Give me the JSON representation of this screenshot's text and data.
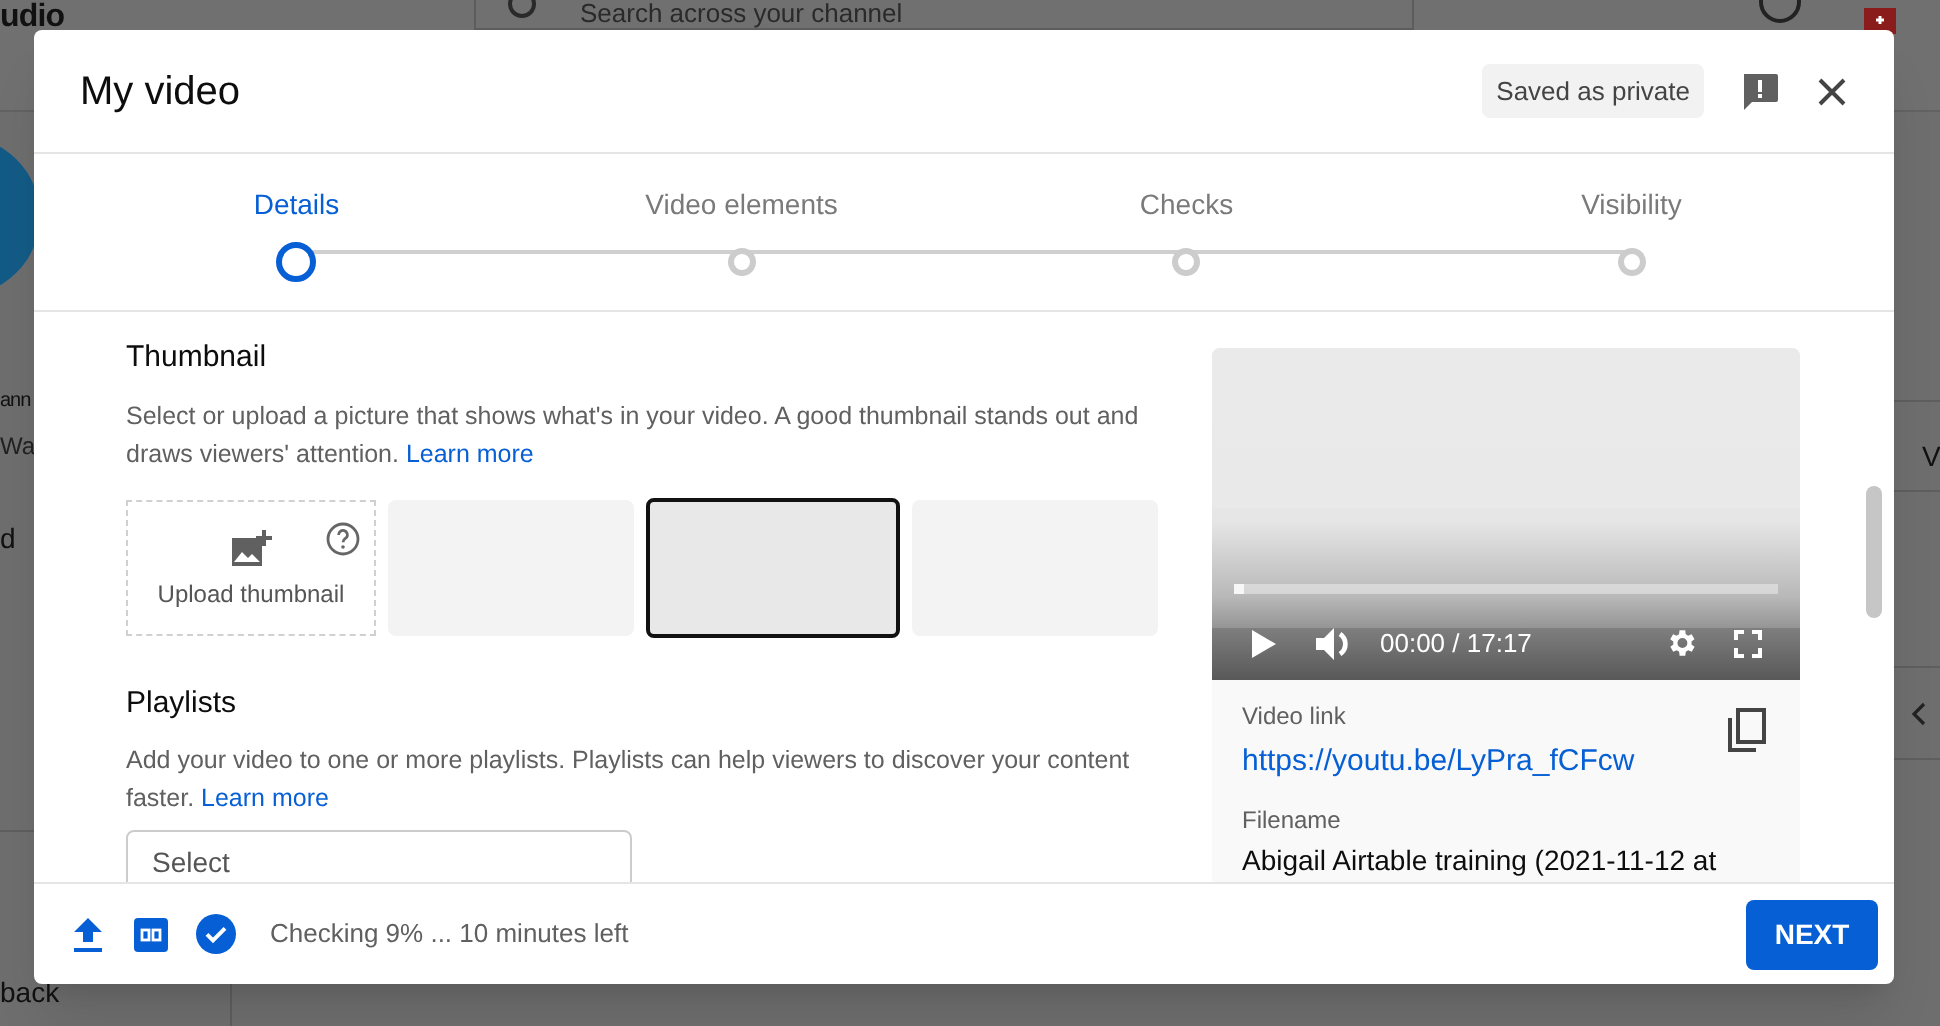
{
  "background": {
    "logo_fragment": "udio",
    "search": {
      "placeholder": "Search across your channel"
    },
    "sidebar_fragments": [
      "ann",
      "Wa",
      "d"
    ],
    "back_fragment": "back",
    "right_fragment": "V"
  },
  "dialog": {
    "title": "My video",
    "save_status": "Saved as private",
    "steps": [
      {
        "label": "Details",
        "selected": true
      },
      {
        "label": "Video elements",
        "selected": false
      },
      {
        "label": "Checks",
        "selected": false
      },
      {
        "label": "Visibility",
        "selected": false
      }
    ],
    "thumbnail": {
      "heading": "Thumbnail",
      "description": "Select or upload a picture that shows what's in your video. A good thumbnail stands out and draws viewers' attention.",
      "link": "Learn more",
      "upload_label": "Upload thumbnail",
      "options": [
        {
          "selected": false
        },
        {
          "selected": true
        },
        {
          "selected": false
        }
      ]
    },
    "playlists": {
      "heading": "Playlists",
      "description": "Add your video to one or more playlists. Playlists can help viewers to discover your content faster.",
      "link": "Learn more",
      "select": {
        "placeholder": "Select"
      }
    },
    "player": {
      "time": "00:00 / 17:17",
      "seek": {
        "level": 0.02
      }
    },
    "details": {
      "link_label": "Video link",
      "link": "https://youtu.be/LyPra_fCFcw",
      "filename_label": "Filename",
      "filename": "Abigail Airtable training (2021-11-12 at"
    },
    "footer": {
      "status": "Checking 9% ... 10 minutes left",
      "next_button": "NEXT"
    }
  }
}
